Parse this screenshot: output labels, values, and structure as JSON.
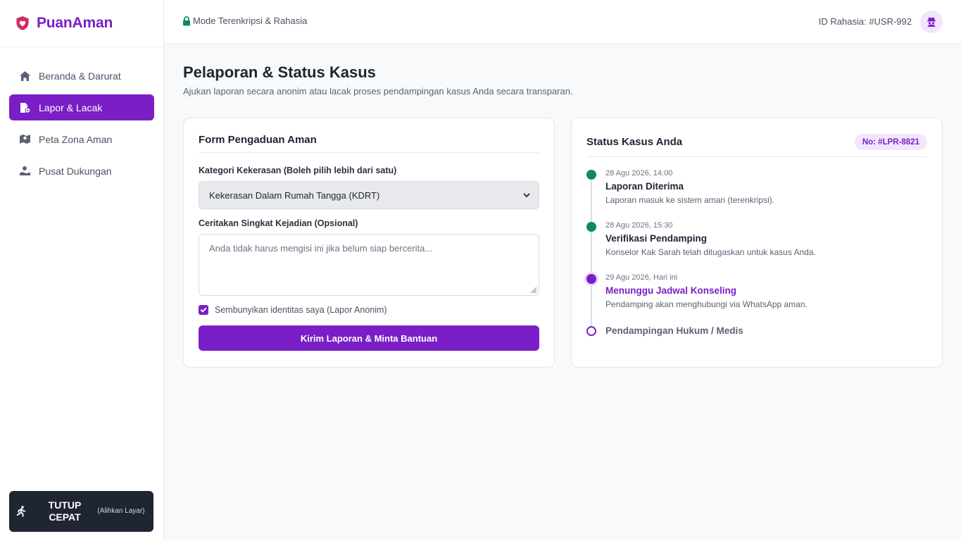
{
  "brand": {
    "name": "PuanAman",
    "accent": "#7a1fc7"
  },
  "sidebar": {
    "items": [
      {
        "label": "Beranda & Darurat",
        "icon": "home-icon",
        "active": false
      },
      {
        "label": "Lapor & Lacak",
        "icon": "report-icon",
        "active": true
      },
      {
        "label": "Peta Zona Aman",
        "icon": "map-icon",
        "active": false
      },
      {
        "label": "Pusat Dukungan",
        "icon": "support-icon",
        "active": false
      }
    ],
    "quick_exit": {
      "label": "TUTUP CEPAT",
      "sub": "(Alihkan Layar)",
      "icon": "running-person-icon"
    }
  },
  "topbar": {
    "mode": "Mode Terenkripsi & Rahasia",
    "user_id": "ID Rahasia: #USR-992",
    "avatar_icon": "anonymous-user-icon"
  },
  "main": {
    "title": "Pelaporan & Status Kasus",
    "subtitle": "Ajukan laporan secara anonim atau lacak proses pendampingan kasus Anda secara transparan."
  },
  "form": {
    "title": "Form Pengaduan Aman",
    "category_label": "Kategori Kekerasan (Boleh pilih lebih dari satu)",
    "category_value": "Kekerasan Dalam Rumah Tangga (KDRT)",
    "story_label": "Ceritakan Singkat Kejadian (Opsional)",
    "story_placeholder": "Anda tidak harus mengisi ini jika belum siap bercerita...",
    "anonymous_label": "Sembunyikan identitas saya (Lapor Anonim)",
    "anonymous_checked": true,
    "submit_label": "Kirim Laporan & Minta Bantuan"
  },
  "status": {
    "title": "Status Kasus Anda",
    "case_no": "No: #LPR-8821",
    "steps": [
      {
        "date": "28 Agu 2026, 14:00",
        "title": "Laporan Diterima",
        "desc": "Laporan masuk ke sistem aman (terenkripsi).",
        "state": "done"
      },
      {
        "date": "28 Agu 2026, 15:30",
        "title": "Verifikasi Pendamping",
        "desc": "Konselor Kak Sarah telah ditugaskan untuk kasus Anda.",
        "state": "done"
      },
      {
        "date": "29 Agu 2026, Hari ini",
        "title": "Menunggu Jadwal Konseling",
        "desc": "Pendamping akan menghubungi via WhatsApp aman.",
        "state": "current"
      },
      {
        "date": "",
        "title": "Pendampingan Hukum / Medis",
        "desc": "",
        "state": "pending"
      }
    ]
  },
  "colors": {
    "primary": "#7a1fc7",
    "success": "#0f8a5f",
    "dark": "#1f2533"
  }
}
